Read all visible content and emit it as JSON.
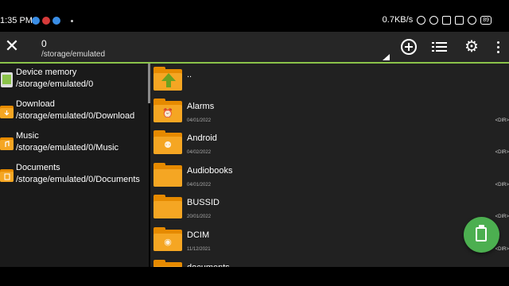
{
  "status_bar": {
    "time": "1:35 PM",
    "speed": "0.7KB/s",
    "battery": "89",
    "notification_colors": [
      "#3a8ee6",
      "#d63a3a",
      "#3a8ee6"
    ]
  },
  "toolbar": {
    "title": "0",
    "path": "/storage/emulated",
    "close_icon": "close-icon",
    "add_icon": "add-circle-icon",
    "list_icon": "list-view-icon",
    "settings_icon": "gear-icon",
    "more_icon": "more-vertical-icon"
  },
  "sidebar": {
    "items": [
      {
        "label": "Device memory",
        "path": "/storage/emulated/0",
        "icon": "phone-icon"
      },
      {
        "label": "Download",
        "path": "/storage/emulated/0/Download",
        "icon": "download-folder-icon"
      },
      {
        "label": "Music",
        "path": "/storage/emulated/0/Music",
        "icon": "music-folder-icon"
      },
      {
        "label": "Documents",
        "path": "/storage/emulated/0/Documents",
        "icon": "document-folder-icon"
      }
    ]
  },
  "files": {
    "up": {
      "label": "..",
      "icon": "folder-up-icon"
    },
    "items": [
      {
        "name": "Alarms",
        "date": "04/01/2022",
        "type": "<DIR>",
        "icon": "alarm-folder-icon"
      },
      {
        "name": "Android",
        "date": "04/02/2022",
        "type": "<DIR>",
        "icon": "android-folder-icon"
      },
      {
        "name": "Audiobooks",
        "date": "04/01/2022",
        "type": "<DIR>",
        "icon": "folder-icon"
      },
      {
        "name": "BUSSID",
        "date": "20/01/2022",
        "type": "<DIR>",
        "icon": "folder-icon"
      },
      {
        "name": "DCIM",
        "date": "11/12/2021",
        "type": "<DIR>",
        "icon": "camera-folder-icon"
      },
      {
        "name": "documents",
        "date": "",
        "type": "",
        "icon": "folder-icon"
      }
    ]
  },
  "fab": {
    "icon": "clipboard-icon"
  },
  "colors": {
    "accent": "#8bc34a",
    "fab": "#4caf50",
    "folder": "#f5a623",
    "folder_dark": "#e68a00"
  }
}
